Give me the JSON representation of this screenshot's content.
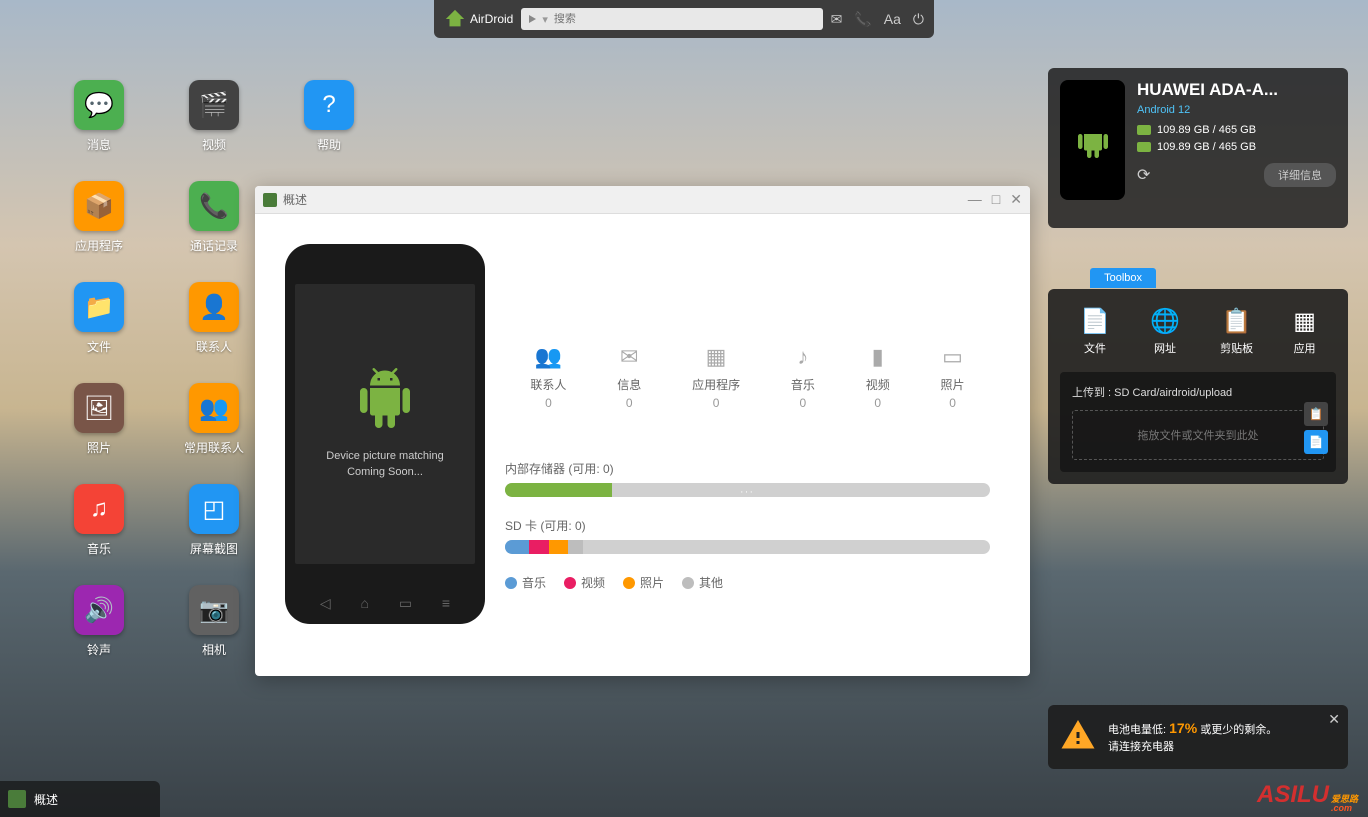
{
  "topbar": {
    "brand": "AirDroid",
    "search_placeholder": "搜索"
  },
  "desktop": [
    {
      "label": "消息",
      "color": "#4caf50"
    },
    {
      "label": "视频",
      "color": "#424242"
    },
    {
      "label": "帮助",
      "color": "#2196f3"
    },
    {
      "label": "应用程序",
      "color": "#ff9800"
    },
    {
      "label": "通话记录",
      "color": "#4caf50"
    },
    {
      "label": "",
      "color": "transparent"
    },
    {
      "label": "文件",
      "color": "#2196f3"
    },
    {
      "label": "联系人",
      "color": "#ff9800"
    },
    {
      "label": "",
      "color": "transparent"
    },
    {
      "label": "照片",
      "color": "#795548"
    },
    {
      "label": "常用联系人",
      "color": "#ff9800"
    },
    {
      "label": "",
      "color": "transparent"
    },
    {
      "label": "音乐",
      "color": "#f44336"
    },
    {
      "label": "屏幕截图",
      "color": "#2196f3"
    },
    {
      "label": "",
      "color": "transparent"
    },
    {
      "label": "铃声",
      "color": "#9c27b0"
    },
    {
      "label": "相机",
      "color": "#616161"
    }
  ],
  "window": {
    "title": "概述",
    "phone_text_line1": "Device picture matching",
    "phone_text_line2": "Coming Soon...",
    "stats": [
      {
        "label": "联系人",
        "value": "0"
      },
      {
        "label": "信息",
        "value": "0"
      },
      {
        "label": "应用程序",
        "value": "0"
      },
      {
        "label": "音乐",
        "value": "0"
      },
      {
        "label": "视频",
        "value": "0"
      },
      {
        "label": "照片",
        "value": "0"
      }
    ],
    "internal_storage_label": "内部存储器 (可用:  0)",
    "sd_card_label": "SD 卡 (可用:  0)",
    "legend": [
      {
        "label": "音乐",
        "color": "#5b9bd5"
      },
      {
        "label": "视频",
        "color": "#e91e63"
      },
      {
        "label": "照片",
        "color": "#ff9800"
      },
      {
        "label": "其他",
        "color": "#bdbdbd"
      }
    ]
  },
  "device": {
    "name": "HUAWEI ADA-A...",
    "os": "Android 12",
    "storage1": "109.89 GB / 465 GB",
    "storage2": "109.89 GB / 465 GB",
    "detail_btn": "详细信息"
  },
  "toolbox": {
    "tab": "Toolbox",
    "tools": [
      {
        "label": "文件"
      },
      {
        "label": "网址"
      },
      {
        "label": "剪贴板"
      },
      {
        "label": "应用"
      }
    ],
    "upload_title": "上传到 : SD Card/airdroid/upload",
    "upload_hint": "拖放文件或文件夹到此处"
  },
  "battery": {
    "prefix": "电池电量低: ",
    "percent": "17%",
    "suffix": " 或更少的剩余。",
    "line2": "请连接充电器"
  },
  "taskbar": {
    "label": "概述"
  },
  "watermark": {
    "main": "ASILU",
    "sub": "爱思路",
    "com": ".com"
  }
}
